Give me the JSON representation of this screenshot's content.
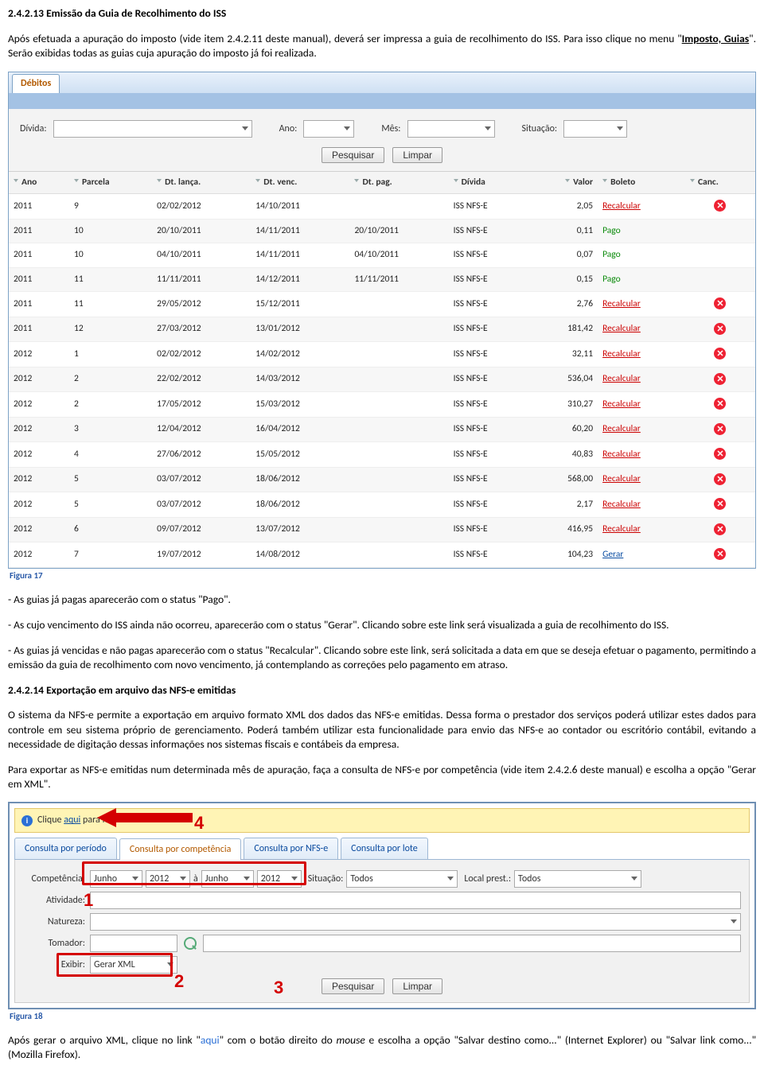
{
  "sec1": {
    "heading": "2.4.2.13 Emissão da Guia de Recolhimento do ISS",
    "p1a": "Após efetuada a apuração do imposto (vide item 2.4.2.11 deste manual), deverá ser impressa a guia de recolhimento do ISS. Para isso clique no menu \"",
    "p1b": "Imposto, Guias",
    "p1c": "\". Serão exibidas todas as guias cuja apuração do imposto já foi realizada."
  },
  "panel1": {
    "tab": "Débitos",
    "filters": {
      "divida": "Dívida:",
      "ano": "Ano:",
      "mes": "Mês:",
      "situacao": "Situação:",
      "pesquisar": "Pesquisar",
      "limpar": "Limpar"
    },
    "headers": [
      "Ano",
      "Parcela",
      "Dt. lança.",
      "Dt. venc.",
      "Dt. pag.",
      "Dívida",
      "Valor",
      "Boleto",
      "Canc."
    ],
    "rows": [
      {
        "ano": "2011",
        "parc": "9",
        "lanc": "02/02/2012",
        "venc": "14/10/2011",
        "pag": "",
        "div": "ISS NFS-E",
        "valor": "2,05",
        "boleto": "Recalcular",
        "cancel": true
      },
      {
        "ano": "2011",
        "parc": "10",
        "lanc": "20/10/2011",
        "venc": "14/11/2011",
        "pag": "20/10/2011",
        "div": "ISS NFS-E",
        "valor": "0,11",
        "boleto": "Pago",
        "cancel": false
      },
      {
        "ano": "2011",
        "parc": "10",
        "lanc": "04/10/2011",
        "venc": "14/11/2011",
        "pag": "04/10/2011",
        "div": "ISS NFS-E",
        "valor": "0,07",
        "boleto": "Pago",
        "cancel": false
      },
      {
        "ano": "2011",
        "parc": "11",
        "lanc": "11/11/2011",
        "venc": "14/12/2011",
        "pag": "11/11/2011",
        "div": "ISS NFS-E",
        "valor": "0,15",
        "boleto": "Pago",
        "cancel": false
      },
      {
        "ano": "2011",
        "parc": "11",
        "lanc": "29/05/2012",
        "venc": "15/12/2011",
        "pag": "",
        "div": "ISS NFS-E",
        "valor": "2,76",
        "boleto": "Recalcular",
        "cancel": true
      },
      {
        "ano": "2011",
        "parc": "12",
        "lanc": "27/03/2012",
        "venc": "13/01/2012",
        "pag": "",
        "div": "ISS NFS-E",
        "valor": "181,42",
        "boleto": "Recalcular",
        "cancel": true
      },
      {
        "ano": "2012",
        "parc": "1",
        "lanc": "02/02/2012",
        "venc": "14/02/2012",
        "pag": "",
        "div": "ISS NFS-E",
        "valor": "32,11",
        "boleto": "Recalcular",
        "cancel": true
      },
      {
        "ano": "2012",
        "parc": "2",
        "lanc": "22/02/2012",
        "venc": "14/03/2012",
        "pag": "",
        "div": "ISS NFS-E",
        "valor": "536,04",
        "boleto": "Recalcular",
        "cancel": true
      },
      {
        "ano": "2012",
        "parc": "2",
        "lanc": "17/05/2012",
        "venc": "15/03/2012",
        "pag": "",
        "div": "ISS NFS-E",
        "valor": "310,27",
        "boleto": "Recalcular",
        "cancel": true
      },
      {
        "ano": "2012",
        "parc": "3",
        "lanc": "12/04/2012",
        "venc": "16/04/2012",
        "pag": "",
        "div": "ISS NFS-E",
        "valor": "60,20",
        "boleto": "Recalcular",
        "cancel": true
      },
      {
        "ano": "2012",
        "parc": "4",
        "lanc": "27/06/2012",
        "venc": "15/05/2012",
        "pag": "",
        "div": "ISS NFS-E",
        "valor": "40,83",
        "boleto": "Recalcular",
        "cancel": true
      },
      {
        "ano": "2012",
        "parc": "5",
        "lanc": "03/07/2012",
        "venc": "18/06/2012",
        "pag": "",
        "div": "ISS NFS-E",
        "valor": "568,00",
        "boleto": "Recalcular",
        "cancel": true
      },
      {
        "ano": "2012",
        "parc": "5",
        "lanc": "03/07/2012",
        "venc": "18/06/2012",
        "pag": "",
        "div": "ISS NFS-E",
        "valor": "2,17",
        "boleto": "Recalcular",
        "cancel": true
      },
      {
        "ano": "2012",
        "parc": "6",
        "lanc": "09/07/2012",
        "venc": "13/07/2012",
        "pag": "",
        "div": "ISS NFS-E",
        "valor": "416,95",
        "boleto": "Recalcular",
        "cancel": true
      },
      {
        "ano": "2012",
        "parc": "7",
        "lanc": "19/07/2012",
        "venc": "14/08/2012",
        "pag": "",
        "div": "ISS NFS-E",
        "valor": "104,23",
        "boleto": "Gerar",
        "cancel": true
      }
    ]
  },
  "fig17": "Figura 17",
  "mid": {
    "p1": "- As guias já pagas aparecerão com o status \"Pago\".",
    "p2": "- As cujo vencimento do ISS ainda não ocorreu, aparecerão com o status \"Gerar\". Clicando sobre este link será visualizada a guia de recolhimento do ISS.",
    "p3": "- As guias já vencidas e não pagas aparecerão com o status \"Recalcular\". Clicando sobre este link, será solicitada a data em que se deseja efetuar o pagamento, permitindo a emissão da guia de recolhimento com novo vencimento, já contemplando as correções pelo pagamento em atraso."
  },
  "sec2": {
    "heading": "2.4.2.14 Exportação em arquivo das NFS-e emitidas",
    "p1": "O sistema da NFS-e permite a exportação em arquivo formato XML dos dados das NFS-e emitidas. Dessa forma o prestador dos serviços poderá utilizar estes dados para controle em seu sistema próprio de gerenciamento. Poderá também utilizar esta funcionalidade para envio das NFS-e ao contador ou escritório contábil, evitando a necessidade de digitação dessas informações nos sistemas fiscais e contábeis da empresa.",
    "p2": "Para exportar as NFS-e emitidas num determinada mês de apuração, faça a consulta de NFS-e por competência (vide item 2.4.2.6 deste manual) e escolha a opção \"Gerar em XML\"."
  },
  "panel2": {
    "banner_pre": "Clique ",
    "banner_link": "aqui",
    "banner_post": " para fazer o download",
    "tabs": {
      "periodo": "Consulta por período",
      "comp": "Consulta por competência",
      "nfse": "Consulta por NFS-e",
      "lote": "Consulta por lote"
    },
    "labels": {
      "comp": "Competência:",
      "a": "à",
      "situ": "Situação:",
      "local": "Local prest.:",
      "ativ": "Atividade:",
      "nat": "Natureza:",
      "tom": "Tomador:",
      "exib": "Exibir:",
      "pesq": "Pesquisar",
      "limp": "Limpar"
    },
    "values": {
      "mes1": "Junho",
      "ano1": "2012",
      "mes2": "Junho",
      "ano2": "2012",
      "situ": "Todos",
      "local": "Todos",
      "exibir": "Gerar XML"
    },
    "red": {
      "n1": "1",
      "n2": "2",
      "n3": "3",
      "n4": "4"
    }
  },
  "fig18": "Figura 18",
  "tail": {
    "a": "Após gerar o arquivo XML, clique no link \"",
    "link": "aqui",
    "b": "\" com o botão direito do ",
    "mouse": "mouse",
    "c": " e escolha a opção \"Salvar destino como...\" (Internet Explorer) ou \"Salvar link como...\" (Mozilla Firefox)."
  }
}
